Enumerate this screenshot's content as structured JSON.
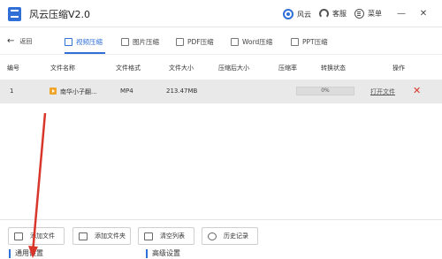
{
  "app": {
    "title": "风云压缩V2.0"
  },
  "titlebar": {
    "user_label": "风云",
    "support_label": "客服",
    "menu_label": "菜单",
    "minimize_glyph": "—",
    "close_glyph": "✕"
  },
  "nav": {
    "back_label": "返回",
    "tabs": [
      {
        "label": "视频压缩",
        "active": true
      },
      {
        "label": "图片压缩",
        "active": false
      },
      {
        "label": "PDF压缩",
        "active": false
      },
      {
        "label": "Word压缩",
        "active": false
      },
      {
        "label": "PPT压缩",
        "active": false
      }
    ]
  },
  "table": {
    "headers": [
      "编号",
      "文件名称",
      "文件格式",
      "文件大小",
      "压缩后大小",
      "压缩率",
      "转换状态",
      "操作"
    ],
    "rows": [
      {
        "index": "1",
        "name": "南华小子翻...",
        "format": "MP4",
        "size": "213.47MB",
        "compressed_size": "",
        "ratio": "",
        "progress_text": "0%",
        "progress": 0,
        "action": "打开文件"
      }
    ]
  },
  "toolbar": {
    "add_file": "添加文件",
    "add_folder": "添加文件夹",
    "clear_list": "清空列表",
    "history": "历史记录"
  },
  "settings": {
    "general": "通用设置",
    "advanced": "高级设置"
  },
  "colors": {
    "accent": "#2f6fd6",
    "delete": "#d9362b",
    "row_bg": "#e9e9e9",
    "annotation": "#d9362b"
  }
}
